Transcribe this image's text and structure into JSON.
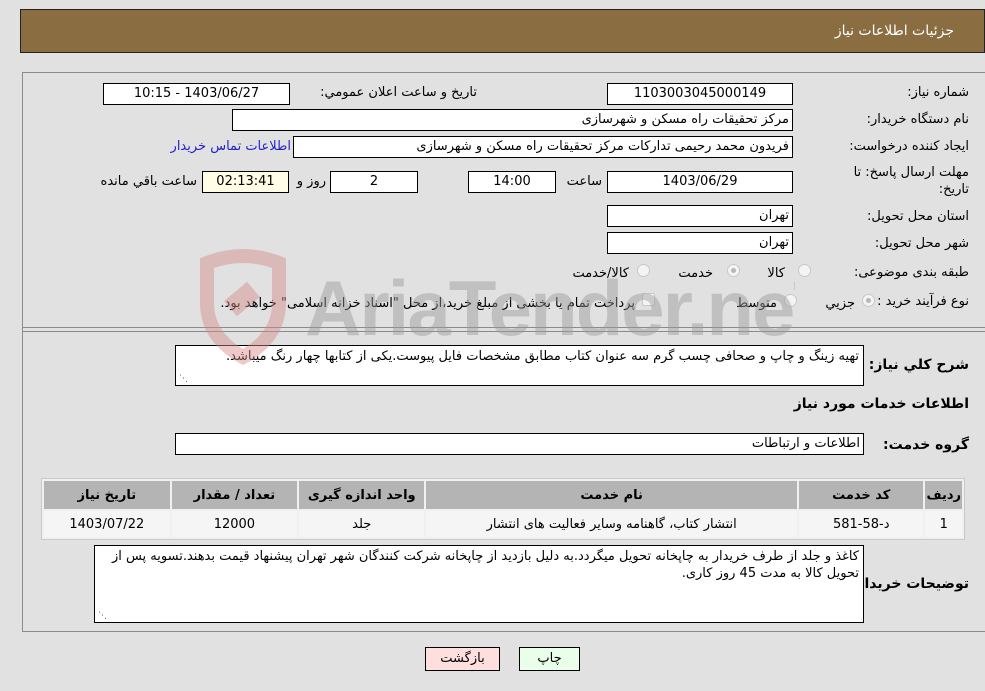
{
  "header": {
    "title": "جزئیات اطلاعات نیاز"
  },
  "fields": {
    "need_number": {
      "label": "شماره نیاز:",
      "value": "1103003045000149"
    },
    "announce_datetime": {
      "label": "تاریخ و ساعت اعلان عمومي:",
      "value": "1403/06/27 - 10:15"
    },
    "buyer_org": {
      "label": "نام دستگاه خریدار:",
      "value": "مرکز تحقیقات راه  مسکن و شهرسازی"
    },
    "requester": {
      "label": "ایجاد کننده درخواست:",
      "value": "فریدون محمد رحیمی تدارکات مرکز تحقیقات راه  مسکن و شهرسازی",
      "contact_link": "اطلاعات تماس خریدار"
    },
    "deadline": {
      "label_line1": "مهلت ارسال پاسخ: تا",
      "label_line2": "تاریخ:",
      "date": "1403/06/29",
      "time_label": "ساعت",
      "time": "14:00",
      "days": "2",
      "days_label": "روز و",
      "remaining": "02:13:41",
      "remaining_label": "ساعت باقي مانده"
    },
    "province": {
      "label": "استان محل تحویل:",
      "value": "تهران"
    },
    "city": {
      "label": "شهر محل تحویل:",
      "value": "تهران"
    },
    "category": {
      "label": "طبقه بندی موضوعی:",
      "options": [
        "کالا",
        "خدمت",
        "کالا/خدمت"
      ],
      "selected": "خدمت"
    },
    "purchase_type": {
      "label": "نوع فرآیند خرید :",
      "options": [
        "جزيي",
        "متوسط"
      ],
      "selected": "جزيي",
      "treasury_checkbox_label": "پرداخت تمام یا بخشی از مبلغ خرید،از محل \"اسناد خزانه اسلامی\" خواهد بود.",
      "treasury_checked": false
    }
  },
  "description": {
    "label": "شرح کلي نیاز:",
    "value": "تهیه زینگ و چاپ و صحافی چسب گرم سه عنوان کتاب مطابق مشخصات فایل پیوست.یکی از کتابها چهار رنگ میباشد."
  },
  "services_section": {
    "title": "اطلاعات خدمات مورد نیاز",
    "group_label": "گروه خدمت:",
    "group_value": "اطلاعات و ارتباطات"
  },
  "table": {
    "headers": [
      "ردیف",
      "کد خدمت",
      "نام خدمت",
      "واحد اندازه گیری",
      "تعداد / مقدار",
      "تاریخ نیاز"
    ],
    "rows": [
      [
        "1",
        "د-58-581",
        "انتشار کتاب، گاهنامه وسایر فعالیت های انتشار",
        "جلد",
        "12000",
        "1403/07/22"
      ]
    ]
  },
  "buyer_notes": {
    "label": "توضیحات خریدار:",
    "value": "کاغذ و جلد از طرف خریدار به چاپخانه تحویل میگردد.به دلیل بازدید از چاپخانه شرکت کنندگان شهر تهران پیشنهاد قیمت بدهند.تسویه پس از تحویل کالا به مدت 45 روز کاری."
  },
  "buttons": {
    "print": "چاپ",
    "back": "بازگشت"
  },
  "watermark": {
    "text": "AriaTender.neT"
  },
  "colors": {
    "header": "#8b6d42",
    "print_button": "#eaffea",
    "back_button": "#ffdede",
    "link": "#2222cc",
    "remaining_bg": "#fffde6"
  }
}
